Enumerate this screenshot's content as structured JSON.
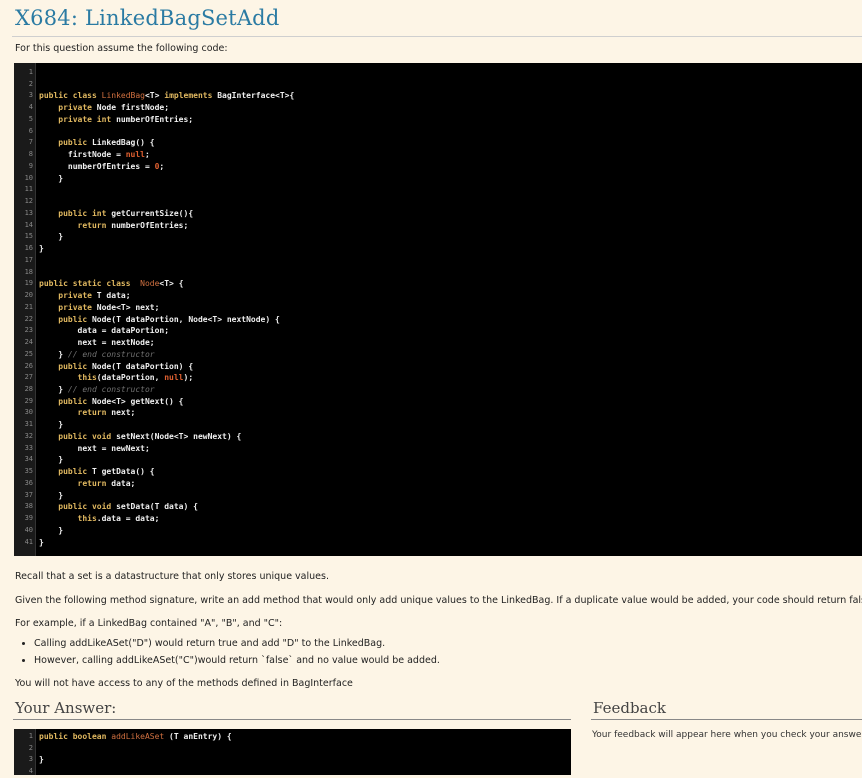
{
  "page": {
    "title": "X684: LinkedBagSetAdd",
    "intro": "For this question assume the following code:",
    "recall": "Recall that a set is a datastructure that only stores unique values.",
    "given": "Given the following method signature, write an add method that would only add unique values to the LinkedBag. If a duplicate value would be added, your code should return false.",
    "example": "For example, if a LinkedBag contained \"A\", \"B\", and \"C\":",
    "bullets": [
      "Calling addLikeASet(\"D\") would return true and add \"D\" to the LinkedBag.",
      "However, calling addLikeASet(\"C\")would return `false` and no value would be added."
    ],
    "note": "You will not have access to any of the methods defined in BagInterface"
  },
  "code_lines": [
    [],
    [],
    [
      [
        "kw",
        "public class "
      ],
      [
        "cls",
        "LinkedBag"
      ],
      [
        "t",
        "<T> "
      ],
      [
        "kw",
        "implements "
      ],
      [
        "t",
        "BagInterface<T>{"
      ]
    ],
    [
      [
        "t",
        "    "
      ],
      [
        "kw",
        "private "
      ],
      [
        "t",
        "Node firstNode;"
      ]
    ],
    [
      [
        "t",
        "    "
      ],
      [
        "kw",
        "private int "
      ],
      [
        "t",
        "numberOfEntries;"
      ]
    ],
    [],
    [
      [
        "t",
        "    "
      ],
      [
        "kw",
        "public "
      ],
      [
        "t",
        "LinkedBag() {"
      ]
    ],
    [
      [
        "t",
        "      firstNode = "
      ],
      [
        "num",
        "null"
      ],
      [
        "t",
        ";"
      ]
    ],
    [
      [
        "t",
        "      numberOfEntries = "
      ],
      [
        "num",
        "0"
      ],
      [
        "t",
        ";"
      ]
    ],
    [
      [
        "t",
        "    }"
      ]
    ],
    [],
    [],
    [
      [
        "t",
        "    "
      ],
      [
        "kw",
        "public int "
      ],
      [
        "t",
        "getCurrentSize(){"
      ]
    ],
    [
      [
        "t",
        "        "
      ],
      [
        "kw",
        "return "
      ],
      [
        "t",
        "numberOfEntries;"
      ]
    ],
    [
      [
        "t",
        "    }"
      ]
    ],
    [
      [
        "t",
        "}"
      ]
    ],
    [],
    [],
    [
      [
        "kw",
        "public static class  "
      ],
      [
        "cls",
        "Node"
      ],
      [
        "t",
        "<T> {"
      ]
    ],
    [
      [
        "t",
        "    "
      ],
      [
        "kw",
        "private "
      ],
      [
        "t",
        "T data;"
      ]
    ],
    [
      [
        "t",
        "    "
      ],
      [
        "kw",
        "private "
      ],
      [
        "t",
        "Node<T> next;"
      ]
    ],
    [
      [
        "t",
        "    "
      ],
      [
        "kw",
        "public "
      ],
      [
        "t",
        "Node(T dataPortion, Node<T> nextNode) {"
      ]
    ],
    [
      [
        "t",
        "        data = dataPortion;"
      ]
    ],
    [
      [
        "t",
        "        next = nextNode;"
      ]
    ],
    [
      [
        "t",
        "    } "
      ],
      [
        "cm",
        "// end constructor"
      ]
    ],
    [
      [
        "t",
        "    "
      ],
      [
        "kw",
        "public "
      ],
      [
        "t",
        "Node(T dataPortion) {"
      ]
    ],
    [
      [
        "t",
        "        "
      ],
      [
        "kw",
        "this"
      ],
      [
        "t",
        "(dataPortion, "
      ],
      [
        "num",
        "null"
      ],
      [
        "t",
        ");"
      ]
    ],
    [
      [
        "t",
        "    } "
      ],
      [
        "cm",
        "// end constructor"
      ]
    ],
    [
      [
        "t",
        "    "
      ],
      [
        "kw",
        "public "
      ],
      [
        "t",
        "Node<T> getNext() {"
      ]
    ],
    [
      [
        "t",
        "        "
      ],
      [
        "kw",
        "return "
      ],
      [
        "t",
        "next;"
      ]
    ],
    [
      [
        "t",
        "    }"
      ]
    ],
    [
      [
        "t",
        "    "
      ],
      [
        "kw",
        "public void "
      ],
      [
        "t",
        "setNext(Node<T> newNext) {"
      ]
    ],
    [
      [
        "t",
        "        next = newNext;"
      ]
    ],
    [
      [
        "t",
        "    }"
      ]
    ],
    [
      [
        "t",
        "    "
      ],
      [
        "kw",
        "public "
      ],
      [
        "t",
        "T getData() {"
      ]
    ],
    [
      [
        "t",
        "        "
      ],
      [
        "kw",
        "return "
      ],
      [
        "t",
        "data;"
      ]
    ],
    [
      [
        "t",
        "    }"
      ]
    ],
    [
      [
        "t",
        "    "
      ],
      [
        "kw",
        "public void "
      ],
      [
        "t",
        "setData(T data) {"
      ]
    ],
    [
      [
        "t",
        "        "
      ],
      [
        "kw",
        "this"
      ],
      [
        "t",
        ".data = data;"
      ]
    ],
    [
      [
        "t",
        "    }"
      ]
    ],
    [
      [
        "t",
        "}"
      ]
    ]
  ],
  "answer": {
    "heading": "Your Answer:",
    "code_lines": [
      [
        [
          "kw",
          "public boolean "
        ],
        [
          "cls",
          "addLikeASet"
        ],
        [
          "t",
          " (T anEntry) {"
        ]
      ],
      [],
      [
        [
          "t",
          "}"
        ]
      ],
      []
    ]
  },
  "feedback": {
    "heading": "Feedback",
    "text": "Your feedback will appear here when you check your answe"
  },
  "colors": {
    "accent": "#2b7ba3",
    "background": "#fdf5e6",
    "code_bg": "#000000",
    "keyword": "#e0b860"
  }
}
